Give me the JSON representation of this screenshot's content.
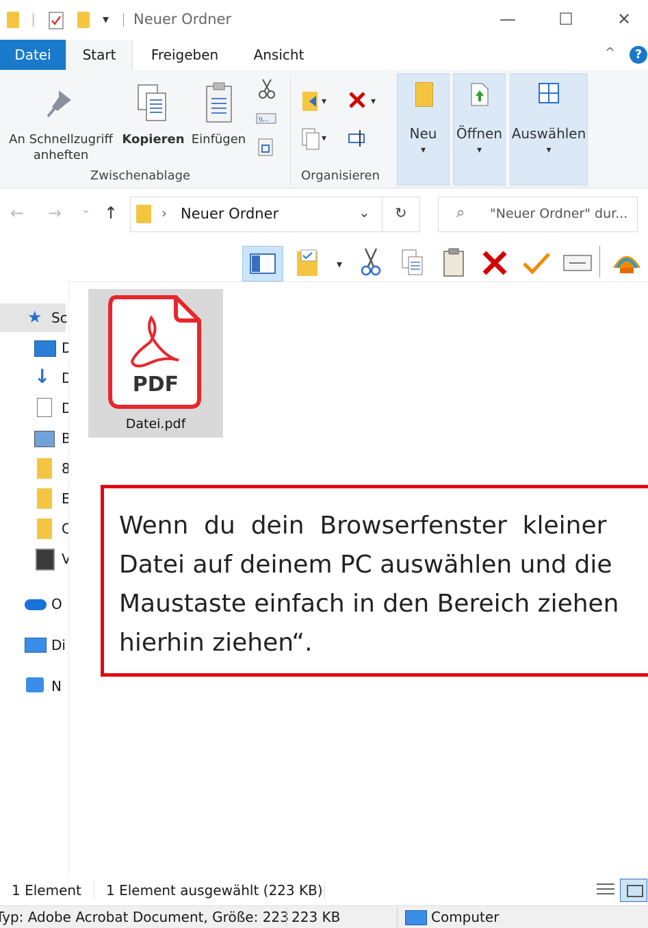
{
  "window": {
    "title": "Neuer Ordner",
    "minimize_glyph": "—",
    "maximize_glyph": "☐",
    "close_glyph": "✕"
  },
  "tabs": {
    "file": "Datei",
    "start": "Start",
    "share": "Freigeben",
    "view": "Ansicht",
    "collapse_glyph": "^",
    "help_glyph": "?"
  },
  "ribbon": {
    "pin_line1": "An Schnellzugriff",
    "pin_line2": "anheften",
    "copy": "Kopieren",
    "paste": "Einfügen",
    "group_clipboard": "Zwischenablage",
    "group_organize": "Organisieren",
    "new": "Neu",
    "open": "Öffnen",
    "select": "Auswählen",
    "dropdown_glyph": "▾"
  },
  "address": {
    "back_glyph": "←",
    "forward_glyph": "→",
    "recent_glyph": "⌄",
    "up_glyph": "↑",
    "crumb_sep": "›",
    "path": "Neuer Ordner",
    "dropdown_glyph": "⌄",
    "refresh_glyph": "↻",
    "search_glyph": "⌕",
    "search_placeholder": "\"Neuer Ordner\" dur..."
  },
  "nav": {
    "quick_access": "Sc",
    "onedrive": "O",
    "this_pc": "Di",
    "network": "N",
    "trunc": [
      "D",
      "D",
      "D",
      "B",
      "8",
      "E",
      "C",
      "V"
    ]
  },
  "file": {
    "name": "Datei.pdf",
    "badge": "PDF"
  },
  "note": {
    "line1": "Wenn  du  dein  Browserfenster  kleiner",
    "line2": "Datei auf deinem PC auswählen und die",
    "line3": "Maustaste einfach in den Bereich ziehen",
    "line4": "hierhin ziehen“."
  },
  "status": {
    "count": "1 Element",
    "selected": "1 Element ausgewählt (223 KB)",
    "type_info": "Typ: Adobe Acrobat Document, Größe: 223",
    "size": "223 KB",
    "computer": "Computer"
  },
  "colors": {
    "accent": "#1979ca",
    "folder": "#f5c542",
    "note_border": "#e30613",
    "pdf_red": "#e8262d",
    "delete_red": "#d20000",
    "check_orange": "#f08a00"
  }
}
